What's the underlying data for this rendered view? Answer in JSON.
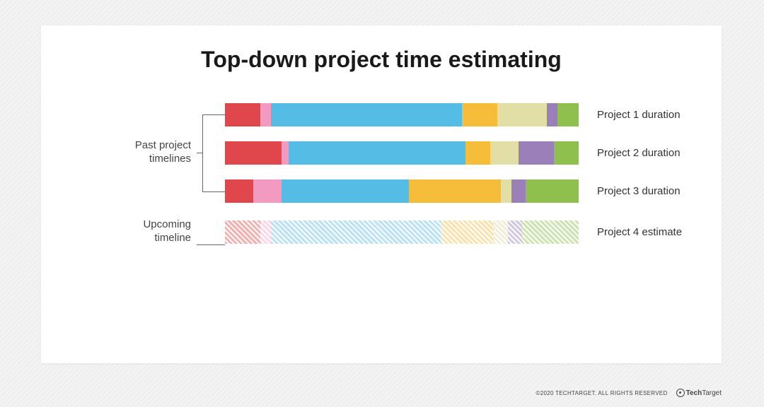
{
  "title": "Top-down project time estimating",
  "group_labels": {
    "past": "Past project\ntimelines",
    "upcoming": "Upcoming\ntimeline"
  },
  "footer": {
    "copyright": "©2020 TECHTARGET. ALL RIGHTS RESERVED",
    "logo_bold": "Tech",
    "logo_light": "Target"
  },
  "chart_data": {
    "type": "bar",
    "orientation": "horizontal-stacked",
    "unit": "percent-of-total-duration",
    "phases": [
      "phase1",
      "phase2",
      "phase3",
      "phase4",
      "phase5",
      "phase6",
      "phase7"
    ],
    "colors": {
      "phase1": "#e0474c",
      "phase2": "#f39ac0",
      "phase3": "#55bce6",
      "phase4": "#f6bd3b",
      "phase5": "#e1dfa6",
      "phase6": "#9b7fb8",
      "phase7": "#8fbf4d"
    },
    "faded_colors": {
      "phase1": "#f3b0ae",
      "phase2": "#fbd6e5",
      "phase3": "#b9e3f5",
      "phase4": "#fbe2ac",
      "phase5": "#efeed6",
      "phase6": "#d2c6e1",
      "phase7": "#cce4af"
    },
    "series": [
      {
        "name": "Project 1 duration",
        "group": "past",
        "faded": false,
        "values": {
          "phase1": 10,
          "phase2": 3,
          "phase3": 54,
          "phase4": 10,
          "phase5": 14,
          "phase6": 3,
          "phase7": 6
        }
      },
      {
        "name": "Project 2 duration",
        "group": "past",
        "faded": false,
        "values": {
          "phase1": 16,
          "phase2": 2,
          "phase3": 50,
          "phase4": 7,
          "phase5": 8,
          "phase6": 10,
          "phase7": 7
        }
      },
      {
        "name": "Project 3 duration",
        "group": "past",
        "faded": false,
        "values": {
          "phase1": 8,
          "phase2": 8,
          "phase3": 36,
          "phase4": 26,
          "phase5": 3,
          "phase6": 4,
          "phase7": 15
        }
      },
      {
        "name": "Project 4 estimate",
        "group": "upcoming",
        "faded": true,
        "values": {
          "phase1": 10,
          "phase2": 3,
          "phase3": 48,
          "phase4": 15,
          "phase5": 4,
          "phase6": 4,
          "phase7": 16
        }
      }
    ]
  }
}
